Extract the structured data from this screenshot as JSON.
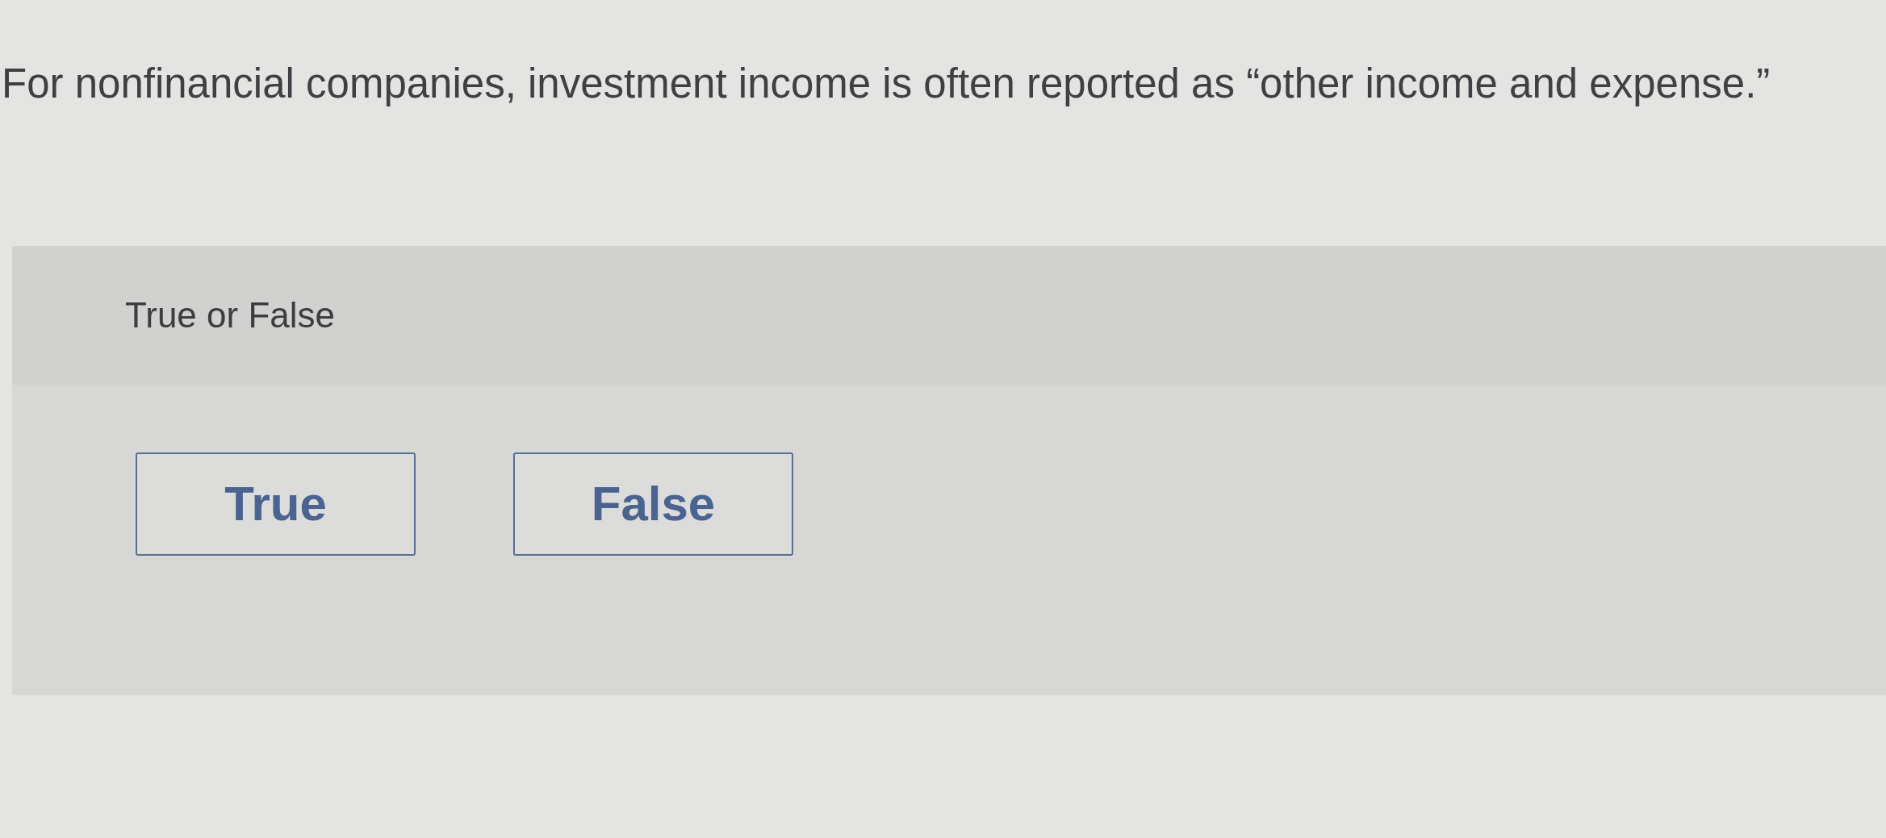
{
  "question": {
    "text": "For nonfinancial companies, investment income is often reported as “other income and expense.”"
  },
  "answer_panel": {
    "prompt": "True or False",
    "options": [
      {
        "label": "True",
        "selected": false
      },
      {
        "label": "False",
        "selected": false
      }
    ]
  }
}
